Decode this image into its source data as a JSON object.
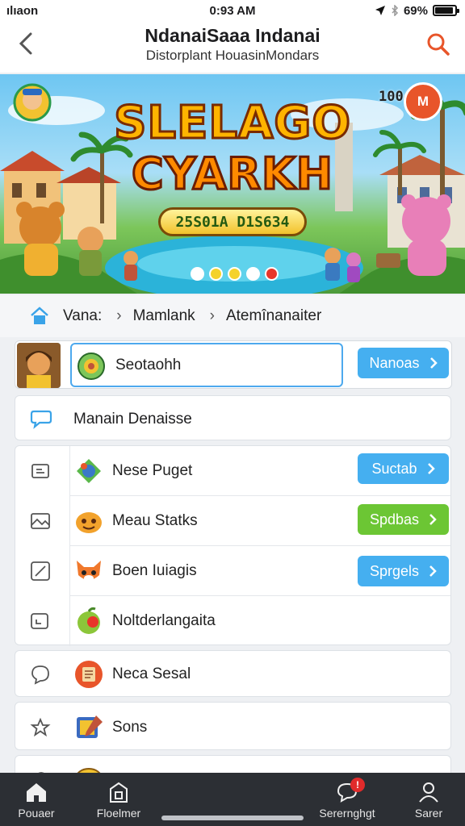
{
  "status": {
    "carrier": "ılıaon",
    "time": "0:93 AM",
    "battery": "69%"
  },
  "header": {
    "title": "NdanaiSaaa Indanai",
    "subtitle": "Distorplant HouasinMondars"
  },
  "banner": {
    "title_line1": "SLELAGO",
    "title_line2": "CYARKH",
    "score": "25S01A D1S634",
    "counter": "1004",
    "coin_label": "M",
    "dots": [
      "#ffffff",
      "#f4d22c",
      "#f4d22c",
      "#ffffff",
      "#e8352a"
    ]
  },
  "breadcrumb": {
    "items": [
      "Vana:",
      "Mamlank",
      "Atemînanaiter"
    ]
  },
  "search_row": {
    "value": "Seotaohh",
    "button": "Nanoas"
  },
  "list": {
    "header": "Manain Denaisse",
    "items": [
      {
        "label": "Nese Puget",
        "button": "Suctab",
        "button_color": "blue"
      },
      {
        "label": "Meau Statks",
        "button": "Spdbas",
        "button_color": "green"
      },
      {
        "label": "Boen Iuiagis",
        "button": "Sprgels",
        "button_color": "blue"
      },
      {
        "label": "Noltderlangaita",
        "button": null
      },
      {
        "label": "Neca Sesal",
        "button": null
      },
      {
        "label": "Sons",
        "button": null
      }
    ]
  },
  "tabbar": {
    "tabs": [
      "Pouaer",
      "Floelmer",
      "Serernghgt",
      "Sarer"
    ],
    "badge": "!"
  },
  "colors": {
    "accent_blue": "#45aff0",
    "accent_green": "#6cc634",
    "search_red": "#e8552a",
    "tabbar": "#2c2f34"
  }
}
